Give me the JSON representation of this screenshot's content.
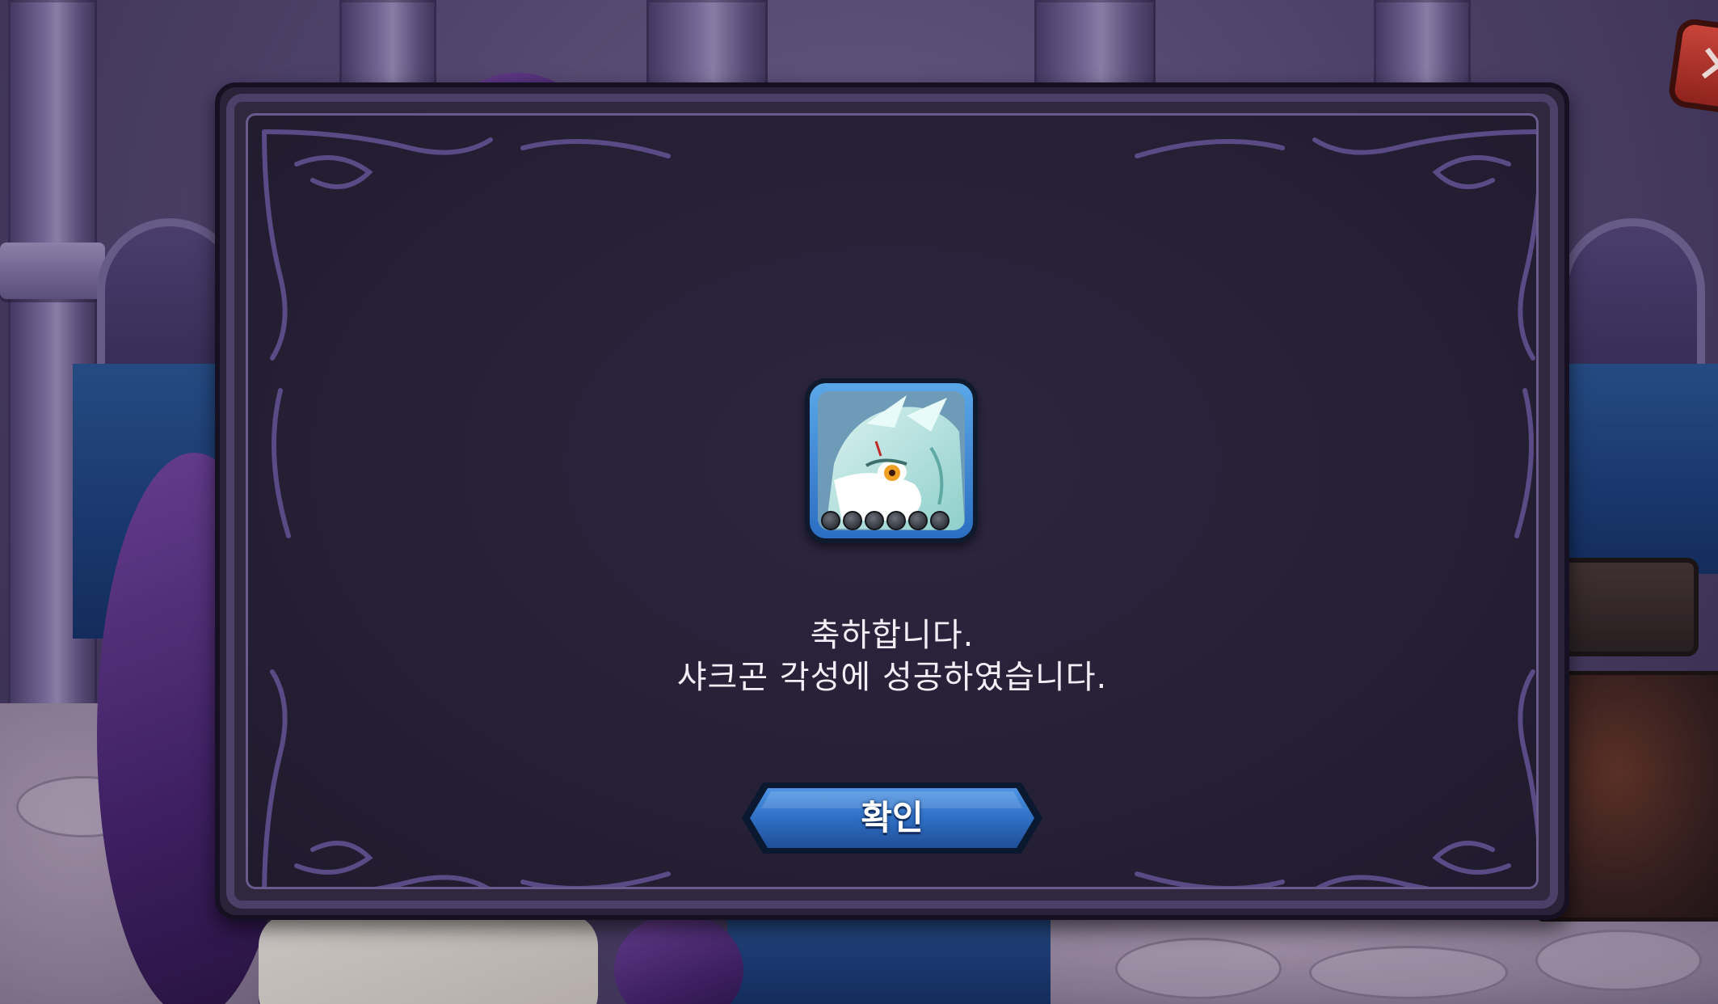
{
  "popup": {
    "message_line1": "축하합니다.",
    "message_line2": "샤크곤 각성에 성공하였습니다.",
    "confirm_label": "확인"
  },
  "reward": {
    "icon": "dragon-portrait-icon",
    "star_slots": 6,
    "stars_filled": 0
  },
  "close": {
    "icon": "close-icon"
  },
  "colors": {
    "dialog_bg": "#262035",
    "dialog_border": "#4d4068",
    "button_blue": "#2f6fc4",
    "text": "#f1eef6"
  }
}
